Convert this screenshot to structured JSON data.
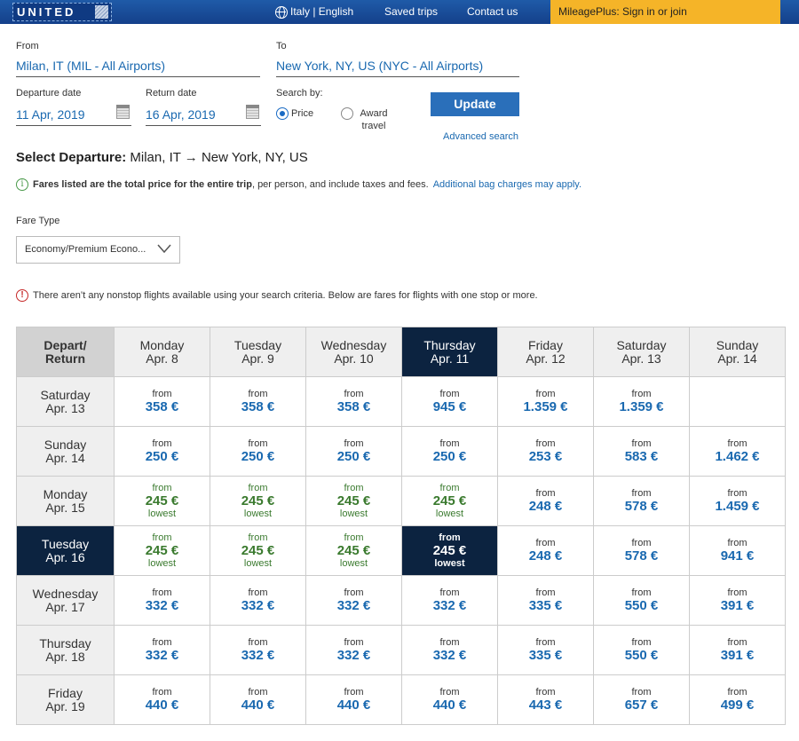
{
  "nav": {
    "logo": "UNITED",
    "language": "Italy | English",
    "saved_trips": "Saved trips",
    "contact_us": "Contact us",
    "mileageplus": "MileagePlus: Sign in or join",
    "colors": {
      "bar": "#1a4f9a",
      "mileage_bg": "#f5b428"
    }
  },
  "search": {
    "from_label": "From",
    "from_value": "Milan, IT (MIL - All Airports)",
    "to_label": "To",
    "to_value": "New York, NY, US (NYC - All Airports)",
    "departure_label": "Departure date",
    "departure_value": "11 Apr, 2019",
    "return_label": "Return date",
    "return_value": "16 Apr, 2019",
    "search_by_label": "Search by:",
    "search_by_options": [
      {
        "label": "Price",
        "selected": true
      },
      {
        "label": "Award travel",
        "selected": false
      }
    ],
    "update_button": "Update",
    "advanced_search": "Advanced search"
  },
  "select_departure": {
    "prefix": "Select Departure:",
    "route": "Milan, IT → New York, NY, US"
  },
  "fare_notice": {
    "bold": "Fares listed are the total price for the entire trip",
    "rest": ", per person, and include taxes and fees.",
    "link": "Additional bag charges may apply."
  },
  "fare_type": {
    "label": "Fare Type",
    "selected": "Economy/Premium Econo..."
  },
  "nonstop_warning": "There aren’t any nonstop flights available using your search criteria. Below are fares for flights with one stop or more.",
  "grid": {
    "corner": [
      "Depart/",
      "Return"
    ],
    "columns": [
      {
        "day": "Monday",
        "date": "Apr. 8"
      },
      {
        "day": "Tuesday",
        "date": "Apr. 9"
      },
      {
        "day": "Wednesday",
        "date": "Apr. 10"
      },
      {
        "day": "Thursday",
        "date": "Apr. 11",
        "selected": true
      },
      {
        "day": "Friday",
        "date": "Apr. 12"
      },
      {
        "day": "Saturday",
        "date": "Apr. 13"
      },
      {
        "day": "Sunday",
        "date": "Apr. 14"
      }
    ],
    "from_label": "from",
    "lowest_label": "lowest",
    "rows": [
      {
        "day": "Saturday",
        "date": "Apr. 13",
        "prices": [
          "358 €",
          "358 €",
          "358 €",
          "945 €",
          "1.359 €",
          "1.359 €",
          null
        ],
        "lowest": [
          false,
          false,
          false,
          false,
          false,
          false,
          false
        ]
      },
      {
        "day": "Sunday",
        "date": "Apr. 14",
        "prices": [
          "250 €",
          "250 €",
          "250 €",
          "250 €",
          "253 €",
          "583 €",
          "1.462 €"
        ],
        "lowest": [
          false,
          false,
          false,
          false,
          false,
          false,
          false
        ]
      },
      {
        "day": "Monday",
        "date": "Apr. 15",
        "prices": [
          "245 €",
          "245 €",
          "245 €",
          "245 €",
          "248 €",
          "578 €",
          "1.459 €"
        ],
        "lowest": [
          true,
          true,
          true,
          true,
          false,
          false,
          false
        ]
      },
      {
        "day": "Tuesday",
        "date": "Apr. 16",
        "selected": true,
        "prices": [
          "245 €",
          "245 €",
          "245 €",
          "245 €",
          "248 €",
          "578 €",
          "941 €"
        ],
        "lowest": [
          true,
          true,
          true,
          true,
          false,
          false,
          false
        ]
      },
      {
        "day": "Wednesday",
        "date": "Apr. 17",
        "prices": [
          "332 €",
          "332 €",
          "332 €",
          "332 €",
          "335 €",
          "550 €",
          "391 €"
        ],
        "lowest": [
          false,
          false,
          false,
          false,
          false,
          false,
          false
        ]
      },
      {
        "day": "Thursday",
        "date": "Apr. 18",
        "prices": [
          "332 €",
          "332 €",
          "332 €",
          "332 €",
          "335 €",
          "550 €",
          "391 €"
        ],
        "lowest": [
          false,
          false,
          false,
          false,
          false,
          false,
          false
        ]
      },
      {
        "day": "Friday",
        "date": "Apr. 19",
        "prices": [
          "440 €",
          "440 €",
          "440 €",
          "440 €",
          "443 €",
          "657 €",
          "499 €"
        ],
        "lowest": [
          false,
          false,
          false,
          false,
          false,
          false,
          false
        ]
      }
    ],
    "colors": {
      "selected": "#0c2340",
      "price": "#1a69b0",
      "lowest": "#3a7a2e"
    }
  }
}
